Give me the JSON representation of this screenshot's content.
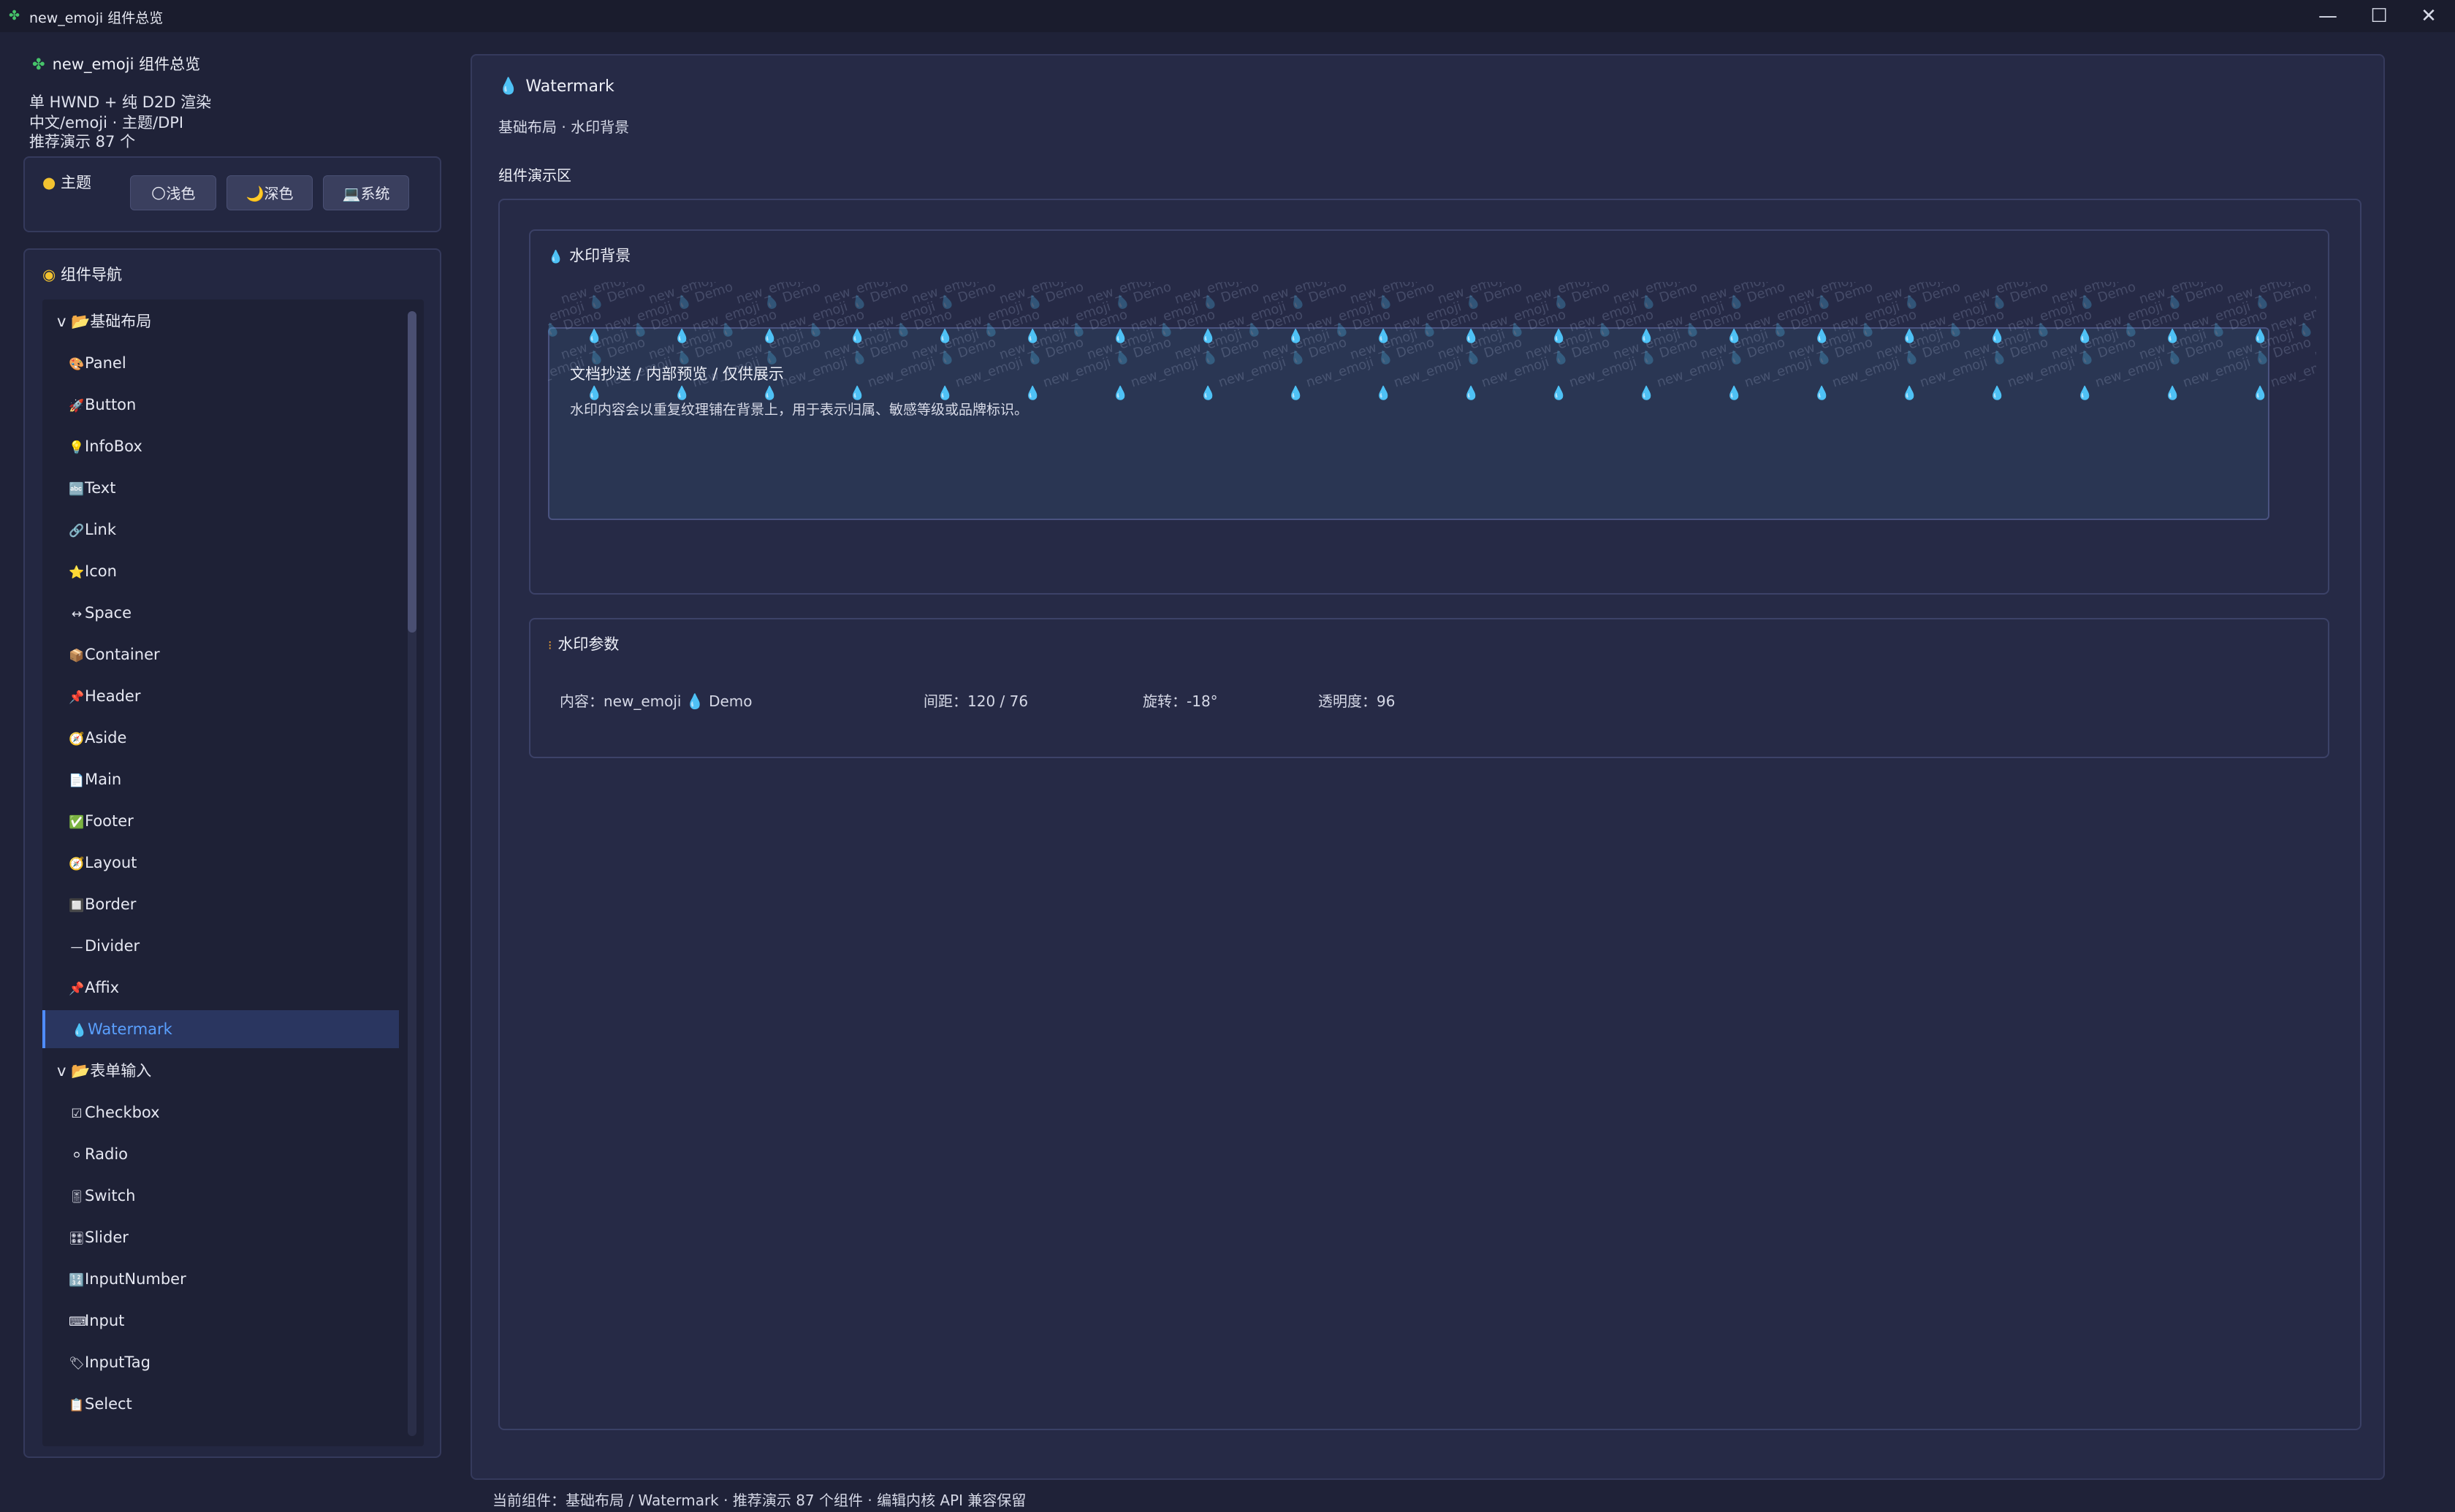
{
  "window": {
    "title": "new_emoji 组件总览",
    "minimize": "—",
    "maximize": "☐",
    "close": "✕"
  },
  "sidebar": {
    "header": "new_emoji 组件总览",
    "info_lines": [
      "单 HWND + 纯 D2D 渲染",
      "中文/emoji · 主题/DPI",
      "推荐演示 87 个"
    ],
    "theme": {
      "label": "主题",
      "buttons": [
        {
          "icon": "🌕",
          "label": "浅色"
        },
        {
          "icon": "🌙",
          "label": "深色"
        },
        {
          "icon": "💻",
          "label": "系统"
        }
      ]
    },
    "nav": {
      "title": "组件导航",
      "items": [
        {
          "kind": "group",
          "icon": "📂",
          "label": "v 📂基础布局"
        },
        {
          "kind": "child",
          "icon": "🎨",
          "label": "Panel"
        },
        {
          "kind": "child",
          "icon": "🚀",
          "label": "Button"
        },
        {
          "kind": "child",
          "icon": "💡",
          "label": "InfoBox"
        },
        {
          "kind": "child",
          "icon": "🔤",
          "label": "Text"
        },
        {
          "kind": "child",
          "icon": "🔗",
          "label": "Link"
        },
        {
          "kind": "child",
          "icon": "⭐",
          "label": "Icon"
        },
        {
          "kind": "child",
          "icon": "↔",
          "label": "Space"
        },
        {
          "kind": "child",
          "icon": "📦",
          "label": "Container"
        },
        {
          "kind": "child",
          "icon": "📌",
          "label": "Header"
        },
        {
          "kind": "child",
          "icon": "🧭",
          "label": "Aside"
        },
        {
          "kind": "child",
          "icon": "📄",
          "label": "Main"
        },
        {
          "kind": "child",
          "icon": "✅",
          "label": "Footer"
        },
        {
          "kind": "child",
          "icon": "🧭",
          "label": "Layout"
        },
        {
          "kind": "child",
          "icon": "🔲",
          "label": "Border"
        },
        {
          "kind": "child",
          "icon": "—",
          "label": "Divider"
        },
        {
          "kind": "child",
          "icon": "📌",
          "label": "Affix"
        },
        {
          "kind": "child",
          "icon": "💧",
          "label": "Watermark",
          "selected": true
        },
        {
          "kind": "group",
          "icon": "📂",
          "label": "v 📂表单输入"
        },
        {
          "kind": "child",
          "icon": "☑",
          "label": "Checkbox"
        },
        {
          "kind": "child",
          "icon": "⚪",
          "label": "Radio"
        },
        {
          "kind": "child",
          "icon": "🎚",
          "label": "Switch"
        },
        {
          "kind": "child",
          "icon": "🎛",
          "label": "Slider"
        },
        {
          "kind": "child",
          "icon": "🔢",
          "label": "InputNumber"
        },
        {
          "kind": "child",
          "icon": "⌨",
          "label": "Input"
        },
        {
          "kind": "child",
          "icon": "🏷",
          "label": "InputTag"
        },
        {
          "kind": "child",
          "icon": "📋",
          "label": "Select"
        }
      ]
    }
  },
  "main": {
    "title": "Watermark",
    "breadcrumb": "基础布局 · 水印背景",
    "demo_label": "组件演示区",
    "watermark_card": {
      "title": "水印背景",
      "heading": "文档抄送 / 内部预览 / 仅供展示",
      "description": "水印内容会以重复纹理铺在背景上，用于表示归属、敏感等级或品牌标识。",
      "watermark_text": "new_emoji 💧 Demo"
    },
    "params_card": {
      "title": "水印参数",
      "content": "内容：new_emoji 💧 Demo",
      "gap": "间距：120 / 76",
      "rotation": "旋转：-18°",
      "opacity": "透明度：96"
    }
  },
  "statusbar": "当前组件：基础布局 / Watermark · 推荐演示 87 个组件 · 编辑内核 API 兼容保留",
  "colors": {
    "background": "#1f2238",
    "accent": "#4f8cff",
    "drop": "#30b8f0"
  }
}
